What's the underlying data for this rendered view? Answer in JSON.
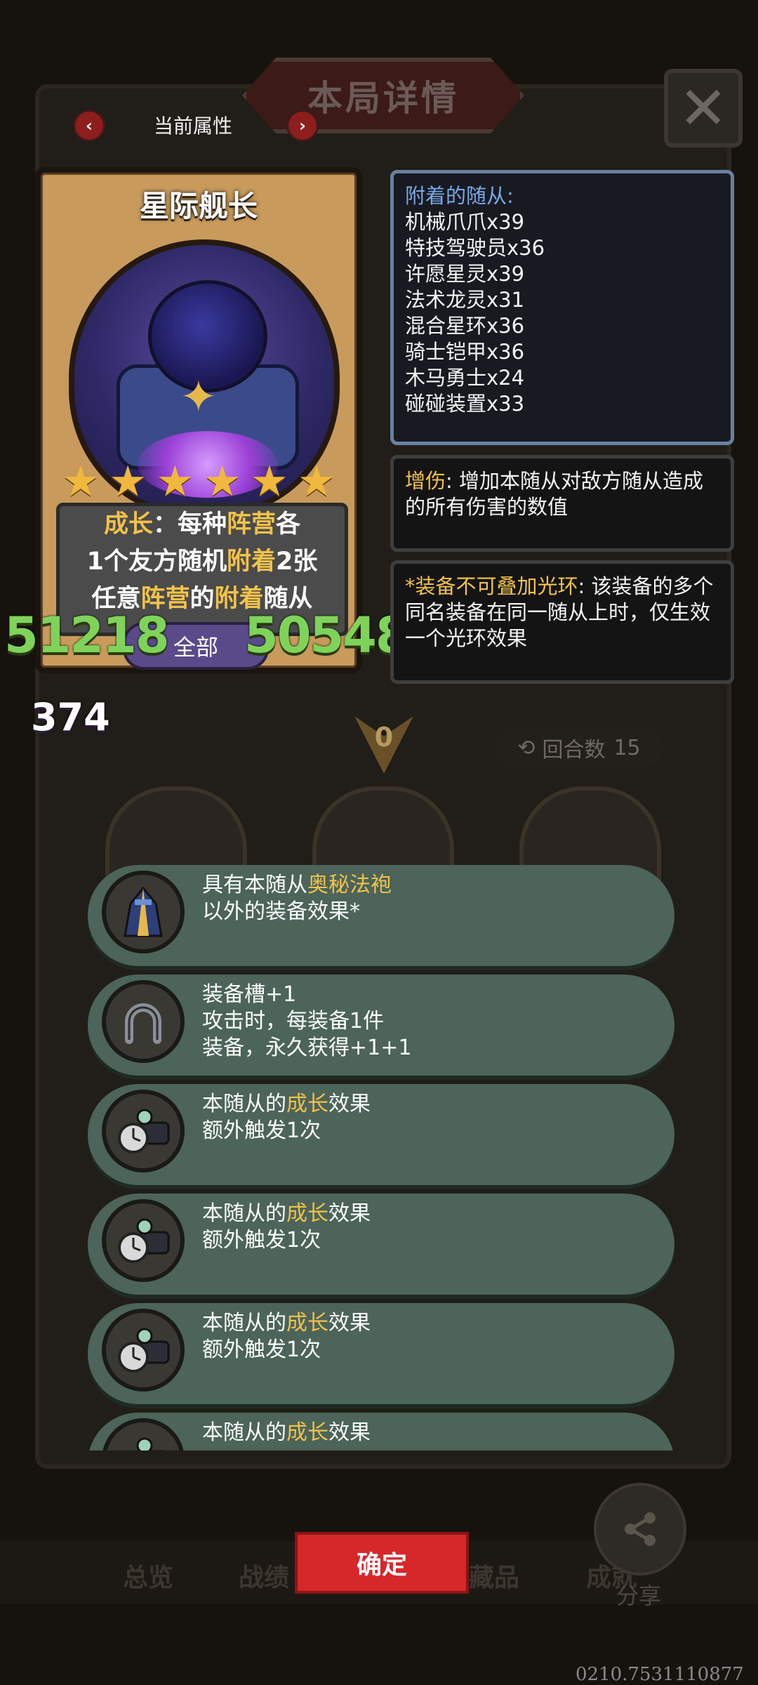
{
  "title": "本局详情",
  "close_label": "✕",
  "attribute": {
    "label": "当前属性",
    "prev": "‹",
    "next": "›"
  },
  "hero": {
    "name": "星际舰长",
    "stars": 6,
    "description": {
      "line1": [
        {
          "text": "成长",
          "highlight": true
        },
        {
          "text": "：每种",
          "highlight": false
        },
        {
          "text": "阵营",
          "highlight": true
        },
        {
          "text": "各",
          "highlight": false
        }
      ],
      "line2": [
        {
          "text": "1个友方随机",
          "highlight": false
        },
        {
          "text": "附着",
          "highlight": true
        },
        {
          "text": "2张",
          "highlight": false
        }
      ],
      "line3": [
        {
          "text": "任意",
          "highlight": false
        },
        {
          "text": "阵营",
          "highlight": true
        },
        {
          "text": "的",
          "highlight": false
        },
        {
          "text": "附着",
          "highlight": true
        },
        {
          "text": "随从",
          "highlight": false
        }
      ]
    },
    "attack": "51218",
    "health": "50548",
    "filter": "全部",
    "counter": "374"
  },
  "attached_panel": {
    "title": "附着的随从:",
    "items": [
      "机械爪爪x39",
      "特技驾驶员x36",
      "许愿星灵x39",
      "法术龙灵x31",
      "混合星环x36",
      "骑士铠甲x36",
      "木马勇士x24",
      "碰碰装置x33"
    ]
  },
  "damage_panel": {
    "keyword": "增伤",
    "text": ": 增加本随从对敌方随从造成的所有伤害的数值"
  },
  "aura_panel": {
    "keyword": "*装备不可叠加光环",
    "text": ": 该装备的多个同名装备在同一随从上时，仅生效一个光环效果"
  },
  "round": {
    "arrow_count": "0",
    "label": "回合数",
    "value": "15"
  },
  "equipment": [
    {
      "icon": "mystic-robe-icon",
      "lines": [
        [
          {
            "t": "具有本随从",
            "h": false
          },
          {
            "t": "奥秘法袍",
            "h": true
          }
        ],
        [
          {
            "t": "以外的装备效果*",
            "h": false
          }
        ]
      ]
    },
    {
      "icon": "horseshoe-icon",
      "lines": [
        [
          {
            "t": "装备槽+1",
            "h": false
          }
        ],
        [
          {
            "t": "攻击时，每装备1件",
            "h": false
          }
        ],
        [
          {
            "t": "装备，永久获得+1+1",
            "h": false
          }
        ]
      ]
    },
    {
      "icon": "gauntlet-watch-icon",
      "lines": [
        [
          {
            "t": "本随从的",
            "h": false
          },
          {
            "t": "成长",
            "h": true
          },
          {
            "t": "效果",
            "h": false
          }
        ],
        [
          {
            "t": "额外触发1次",
            "h": false
          }
        ]
      ]
    },
    {
      "icon": "gauntlet-watch-icon",
      "lines": [
        [
          {
            "t": "本随从的",
            "h": false
          },
          {
            "t": "成长",
            "h": true
          },
          {
            "t": "效果",
            "h": false
          }
        ],
        [
          {
            "t": "额外触发1次",
            "h": false
          }
        ]
      ]
    },
    {
      "icon": "gauntlet-watch-icon",
      "lines": [
        [
          {
            "t": "本随从的",
            "h": false
          },
          {
            "t": "成长",
            "h": true
          },
          {
            "t": "效果",
            "h": false
          }
        ],
        [
          {
            "t": "额外触发1次",
            "h": false
          }
        ]
      ]
    },
    {
      "icon": "gauntlet-watch-icon",
      "lines": [
        [
          {
            "t": "本随从的",
            "h": false
          },
          {
            "t": "成长",
            "h": true
          },
          {
            "t": "效果",
            "h": false
          }
        ]
      ]
    }
  ],
  "bottom_tabs": [
    "总览",
    "战绩",
    "藏品",
    "成就"
  ],
  "confirm_label": "确定",
  "share_label": "分享",
  "code": "0210.7531110877",
  "colors": {
    "highlight": "#f2c24a",
    "equip_bg": "#4c6459",
    "confirm": "#d6272b",
    "stat_green": "#7fd35a"
  }
}
